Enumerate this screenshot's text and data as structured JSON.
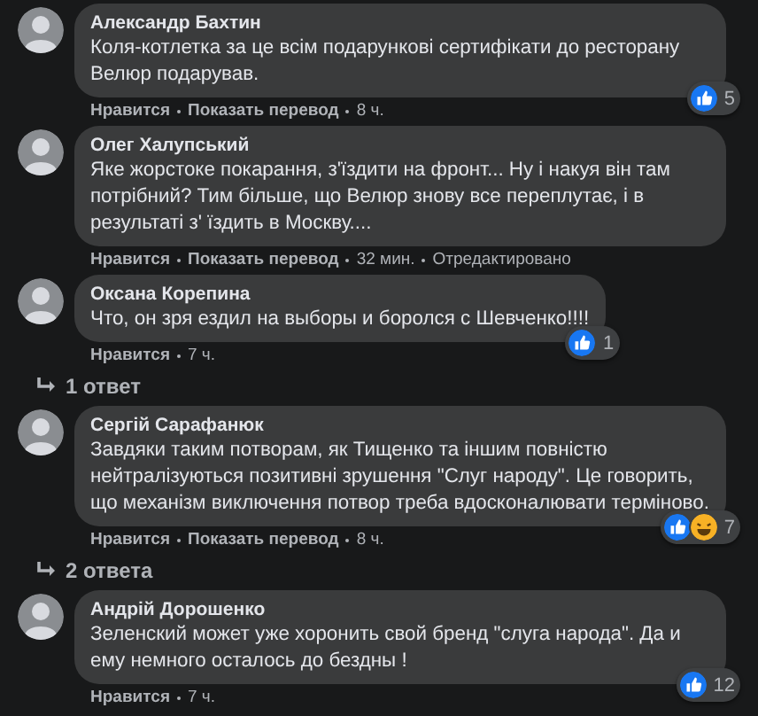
{
  "comments": [
    {
      "author": "Александр Бахтин",
      "text": "Коля-котлетка за це всім подарункові сертифікати до ресторану Велюр подарував.",
      "actions": [
        "Нравится",
        "Показать перевод",
        "8 ч."
      ],
      "reactions": {
        "icons": [
          {
            "kind": "like"
          }
        ],
        "count": "5"
      }
    },
    {
      "author": "Олег Халупський",
      "text": "Яке жорстоке покарання, з'їздити на фронт... Ну і накуя він там потрібний? Тим більше, що Велюр знову все переплутає, і в результаті з' їздить в Москву....",
      "actions": [
        "Нравится",
        "Показать перевод",
        "32 мин.",
        "Отредактировано"
      ]
    },
    {
      "author": "Оксана Корепина",
      "text": "Что, он зря ездил на выборы и боролся с Шевченко!!!!",
      "actions": [
        "Нравится",
        "7 ч."
      ],
      "reactions": {
        "icons": [
          {
            "kind": "like"
          }
        ],
        "count": "1"
      },
      "replies": "1 ответ"
    },
    {
      "author": "Сергій Сарафанюк",
      "text": "Завдяки таким потворам, як Тищенко та іншим повністю нейтралізуються позитивні зрушення \"Слуг народу\". Це говорить, що механізм виключення потвор треба вдосконалювати терміново.",
      "actions": [
        "Нравится",
        "Показать перевод",
        "8 ч."
      ],
      "reactions": {
        "icons": [
          {
            "kind": "like"
          },
          {
            "kind": "haha"
          }
        ],
        "count": "7"
      },
      "replies": "2 ответа"
    },
    {
      "author": "Андрій Дорошенко",
      "text": "Зеленский может уже хоронить свой бренд \"слуга народа\". Да и ему немного осталось до бездны !",
      "actions": [
        "Нравится",
        "7 ч."
      ],
      "reactions": {
        "icons": [
          {
            "kind": "like"
          }
        ],
        "count": "12"
      }
    }
  ]
}
